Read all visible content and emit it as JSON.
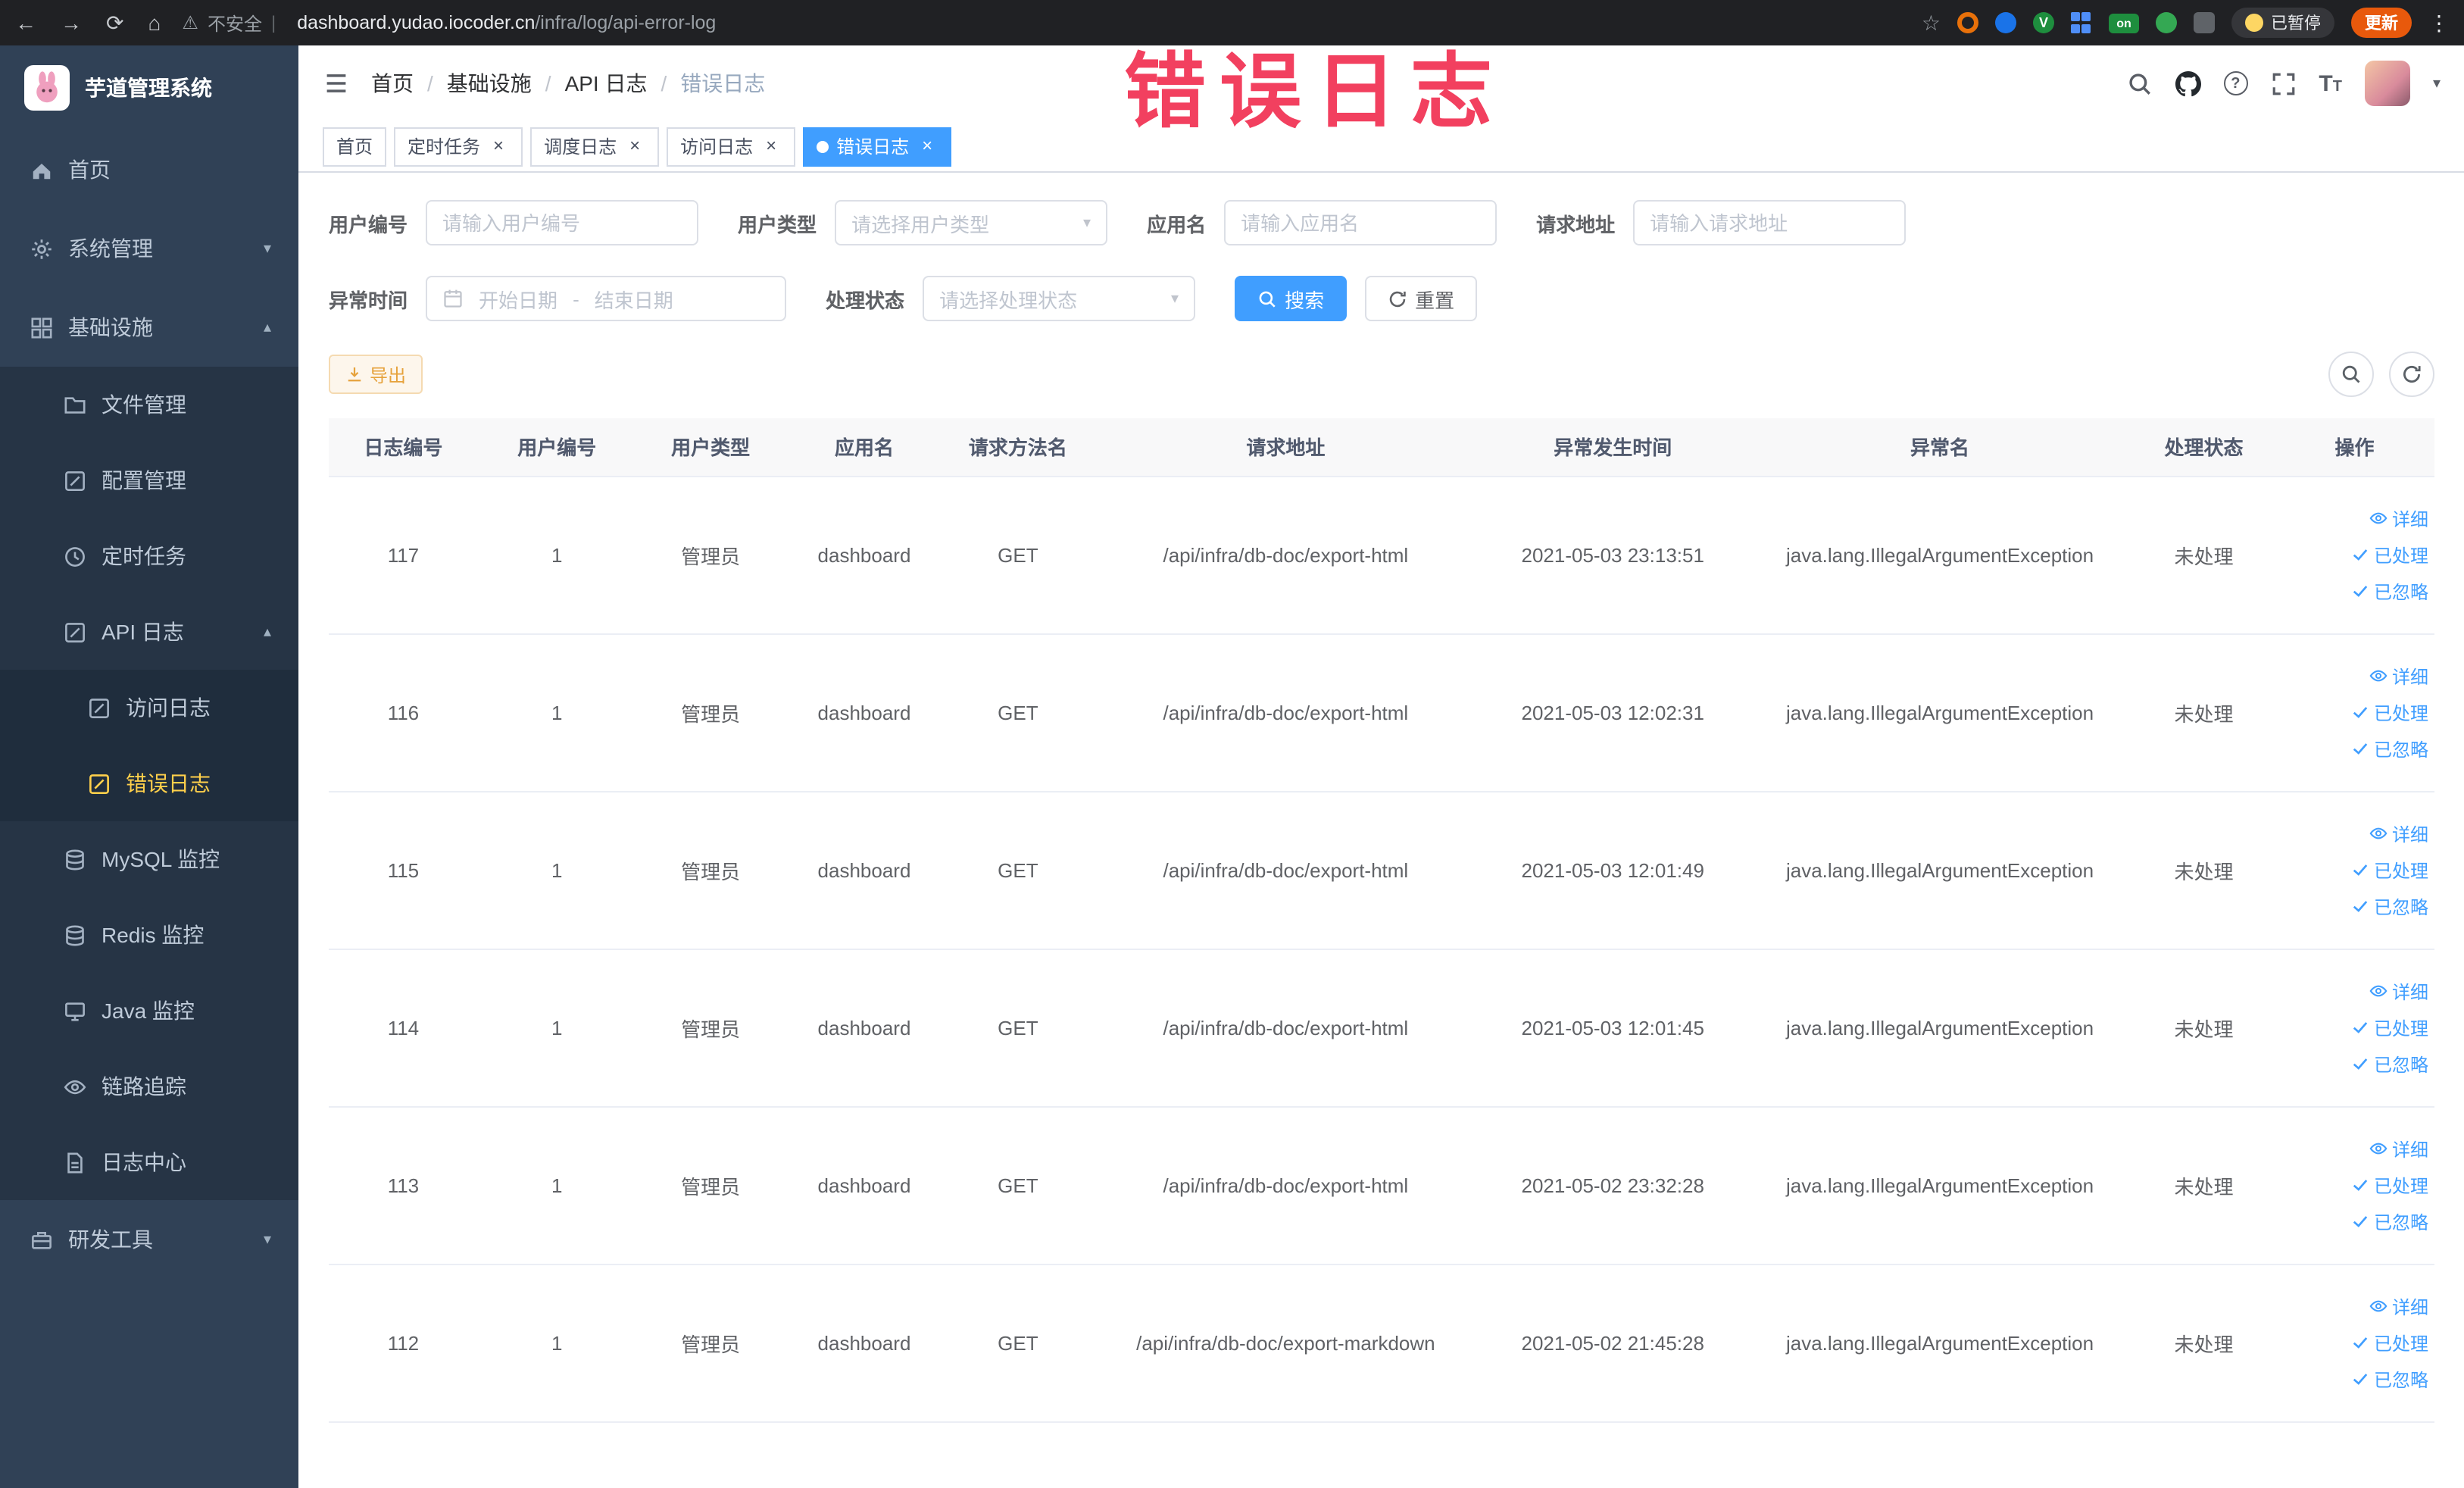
{
  "glyphs": {
    "back": "←",
    "forward": "→",
    "reload": "⟳",
    "home": "⌂",
    "warning": "⚠",
    "pipe": "|",
    "star": "☆",
    "v": "V",
    "on": "on",
    "kebab": "⋮",
    "help": "?",
    "slash": "/",
    "caret_down": "▾",
    "caret_up": "▴",
    "close": "×",
    "big_t": "T",
    "small_t": "T"
  },
  "browser": {
    "security_text": "不安全",
    "url_host": "dashboard.yudao.iocoder.cn",
    "url_path": "/infra/log/api-error-log",
    "paused_label": "已暂停",
    "update_label": "更新"
  },
  "annotation": {
    "text": "错误日志"
  },
  "sidebar": {
    "logo_title": "芋道管理系统",
    "items": [
      {
        "label": "首页"
      },
      {
        "label": "系统管理"
      },
      {
        "label": "基础设施"
      },
      {
        "label": "文件管理"
      },
      {
        "label": "配置管理"
      },
      {
        "label": "定时任务"
      },
      {
        "label": "API 日志"
      },
      {
        "label": "访问日志"
      },
      {
        "label": "错误日志"
      },
      {
        "label": "MySQL 监控"
      },
      {
        "label": "Redis 监控"
      },
      {
        "label": "Java 监控"
      },
      {
        "label": "链路追踪"
      },
      {
        "label": "日志中心"
      },
      {
        "label": "研发工具"
      }
    ]
  },
  "breadcrumb": {
    "items": [
      "首页",
      "基础设施",
      "API 日志",
      "错误日志"
    ]
  },
  "tabs": [
    {
      "label": "首页"
    },
    {
      "label": "定时任务"
    },
    {
      "label": "调度日志"
    },
    {
      "label": "访问日志"
    },
    {
      "label": "错误日志"
    }
  ],
  "filters": {
    "user_id": {
      "label": "用户编号",
      "placeholder": "请输入用户编号"
    },
    "user_type": {
      "label": "用户类型",
      "placeholder": "请选择用户类型"
    },
    "app_name": {
      "label": "应用名",
      "placeholder": "请输入应用名"
    },
    "request_url": {
      "label": "请求地址",
      "placeholder": "请输入请求地址"
    },
    "exception_time": {
      "label": "异常时间",
      "start_placeholder": "开始日期",
      "separator": "-",
      "end_placeholder": "结束日期"
    },
    "process_status": {
      "label": "处理状态",
      "placeholder": "请选择处理状态"
    },
    "search_button": "搜索",
    "reset_button": "重置"
  },
  "toolbar": {
    "export_label": "导出"
  },
  "table": {
    "columns": [
      "日志编号",
      "用户编号",
      "用户类型",
      "应用名",
      "请求方法名",
      "请求地址",
      "异常发生时间",
      "异常名",
      "处理状态",
      "操作"
    ],
    "action_labels": {
      "detail": "详细",
      "processed": "已处理",
      "ignored": "已忽略"
    },
    "rows": [
      {
        "id": "117",
        "user_id": "1",
        "user_type": "管理员",
        "app_name": "dashboard",
        "method": "GET",
        "url": "/api/infra/db-doc/export-html",
        "time": "2021-05-03 23:13:51",
        "exception": "java.lang.IllegalArgumentException",
        "status": "未处理"
      },
      {
        "id": "116",
        "user_id": "1",
        "user_type": "管理员",
        "app_name": "dashboard",
        "method": "GET",
        "url": "/api/infra/db-doc/export-html",
        "time": "2021-05-03 12:02:31",
        "exception": "java.lang.IllegalArgumentException",
        "status": "未处理"
      },
      {
        "id": "115",
        "user_id": "1",
        "user_type": "管理员",
        "app_name": "dashboard",
        "method": "GET",
        "url": "/api/infra/db-doc/export-html",
        "time": "2021-05-03 12:01:49",
        "exception": "java.lang.IllegalArgumentException",
        "status": "未处理"
      },
      {
        "id": "114",
        "user_id": "1",
        "user_type": "管理员",
        "app_name": "dashboard",
        "method": "GET",
        "url": "/api/infra/db-doc/export-html",
        "time": "2021-05-03 12:01:45",
        "exception": "java.lang.IllegalArgumentException",
        "status": "未处理"
      },
      {
        "id": "113",
        "user_id": "1",
        "user_type": "管理员",
        "app_name": "dashboard",
        "method": "GET",
        "url": "/api/infra/db-doc/export-html",
        "time": "2021-05-02 23:32:28",
        "exception": "java.lang.IllegalArgumentException",
        "status": "未处理"
      },
      {
        "id": "112",
        "user_id": "1",
        "user_type": "管理员",
        "app_name": "dashboard",
        "method": "GET",
        "url": "/api/infra/db-doc/export-markdown",
        "time": "2021-05-02 21:45:28",
        "exception": "java.lang.IllegalArgumentException",
        "status": "未处理"
      }
    ]
  }
}
